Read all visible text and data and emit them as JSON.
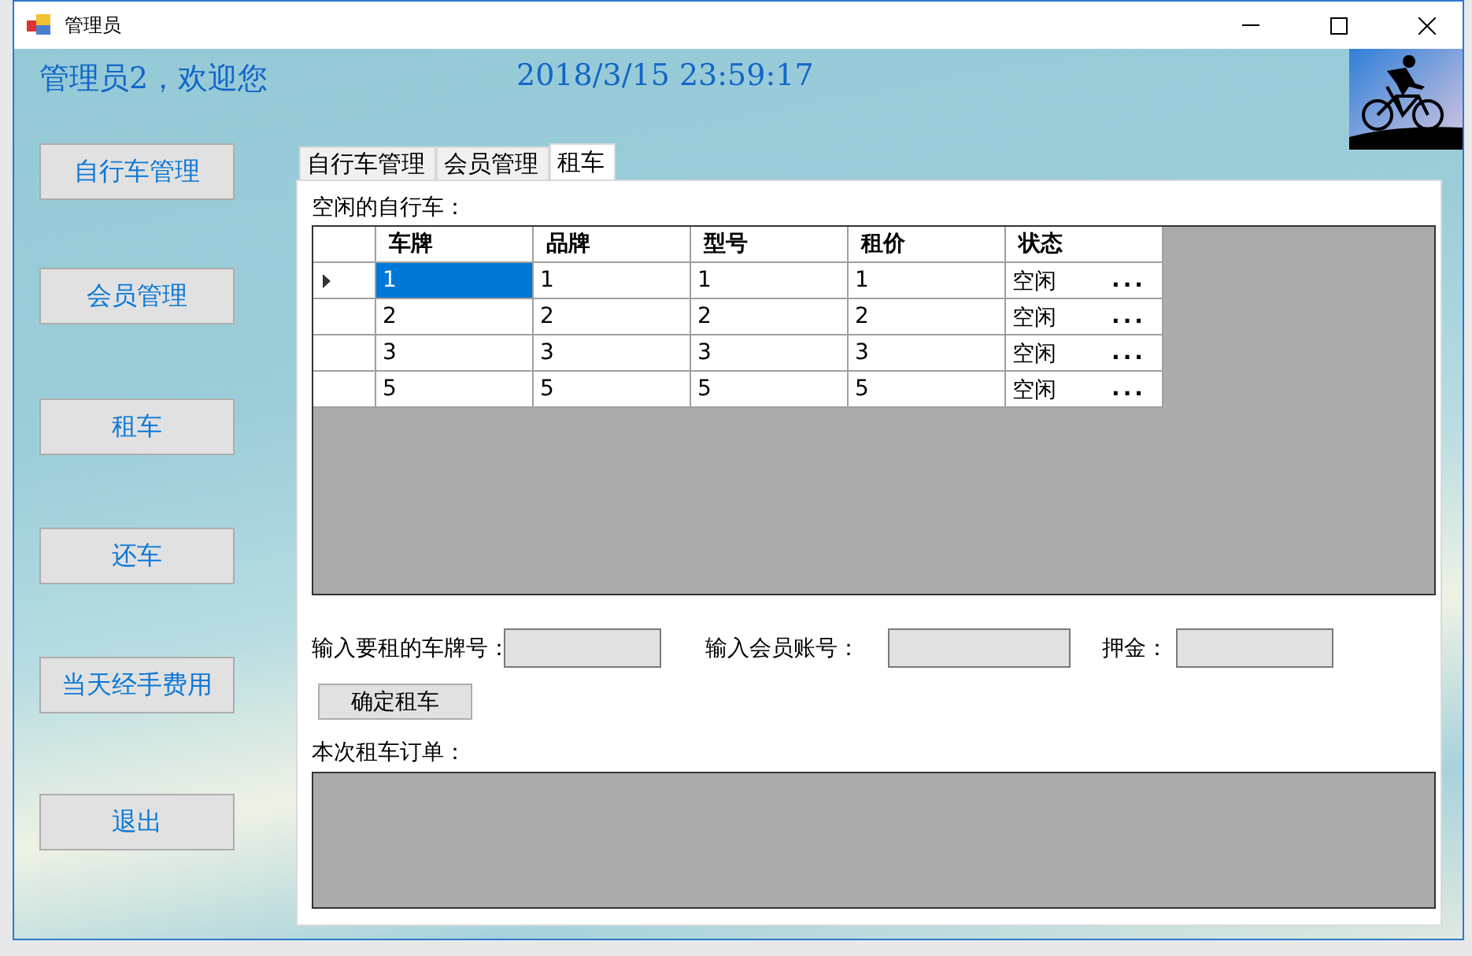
{
  "window": {
    "title": "管理员"
  },
  "header": {
    "welcome": "管理员2，欢迎您",
    "datetime": "2018/3/15  23:59:17"
  },
  "sidebar": {
    "items": [
      {
        "label": "自行车管理"
      },
      {
        "label": "会员管理"
      },
      {
        "label": "租车"
      },
      {
        "label": "还车"
      },
      {
        "label": "当天经手费用"
      },
      {
        "label": "退出"
      }
    ]
  },
  "tabs": [
    {
      "label": "自行车管理",
      "selected": false
    },
    {
      "label": "会员管理",
      "selected": false
    },
    {
      "label": "租车",
      "selected": true
    }
  ],
  "idle_bikes": {
    "title": "空闲的自行车：",
    "columns": [
      "车牌",
      "品牌",
      "型号",
      "租价",
      "状态"
    ],
    "rows": [
      {
        "cells": [
          "1",
          "1",
          "1",
          "1",
          "空闲"
        ],
        "action": "...",
        "selected": true
      },
      {
        "cells": [
          "2",
          "2",
          "2",
          "2",
          "空闲"
        ],
        "action": "...",
        "selected": false
      },
      {
        "cells": [
          "3",
          "3",
          "3",
          "3",
          "空闲"
        ],
        "action": "...",
        "selected": false
      },
      {
        "cells": [
          "5",
          "5",
          "5",
          "5",
          "空闲"
        ],
        "action": "...",
        "selected": false
      }
    ]
  },
  "form": {
    "plate_label": "输入要租的车牌号：",
    "member_label": "输入会员账号：",
    "deposit_label": "押金：",
    "confirm_button": "确定租车"
  },
  "order": {
    "title": "本次租车订单："
  }
}
